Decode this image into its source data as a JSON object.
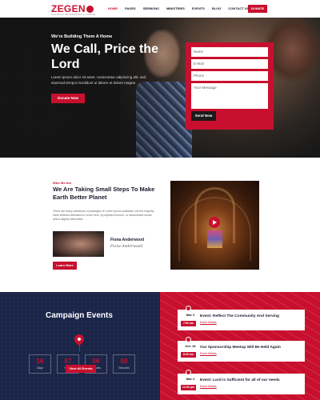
{
  "nav": {
    "logo": "ZEGEN",
    "logo_sub": "CHURCH WORDPRESS THEME",
    "items": [
      "HOME",
      "PAGES",
      "SERMONS",
      "MINISTRIES",
      "EVENTS",
      "BLOG",
      "CONTACT US"
    ],
    "donate": "DONATE"
  },
  "hero": {
    "kicker": "We're Building Them A Home",
    "title": "We Call, Price the Lord",
    "text": "Lorem ipsum dolor sit amet, consectetur adipiscing elit, sed eiusmod tempor incididunt ut labore et dolore magna",
    "button": "Donate Now"
  },
  "form": {
    "name": "Name",
    "email": "E-Mail",
    "phone": "Phone",
    "message": "Your Message",
    "send": "Send Now"
  },
  "about": {
    "kicker": "Who We Are",
    "title": "We Are Taking Small Steps To Make Earth Better Planet",
    "text": "There are many variations of passages of Lorem Ipsum available, but the majority have suffered alteration in some form, by injected humour, or randomised words which slightly believable.",
    "founder_name": "Fiona Anderwood",
    "founder_sig": "Fiona Anderwood",
    "button": "Learn More"
  },
  "campaign": {
    "title": "Campaign Events",
    "countdown": [
      {
        "value": "16",
        "label": "Days"
      },
      {
        "value": "07",
        "label": "Hours"
      },
      {
        "value": "06",
        "label": "Minutes"
      },
      {
        "value": "00",
        "label": "Seconds"
      }
    ],
    "button": "View All Events"
  },
  "events": [
    {
      "date": "Mar 3",
      "time": "7:00 am",
      "name": "Event: Reflect The Community And Serving",
      "link": "Event Details"
    },
    {
      "date": "Dec 18",
      "time": "8:00 am",
      "name": "Our Sponsorship Meetup Will Be Held Again",
      "link": "Event Details"
    },
    {
      "date": "Mar 4",
      "time": "12:00 pm",
      "name": "Event: Lord is Sufficient for all of our needs",
      "link": "Event Details"
    }
  ]
}
